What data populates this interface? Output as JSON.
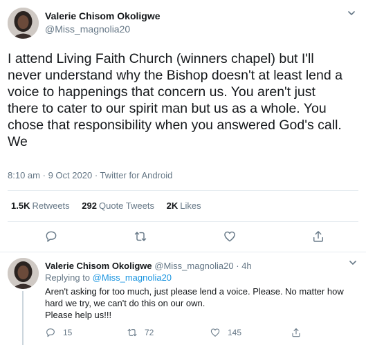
{
  "main_tweet": {
    "author_name": "Valerie Chisom Okoligwe",
    "author_handle": "@Miss_magnolia20",
    "text": "I attend Living Faith Church (winners chapel) but I'll\nnever understand why the Bishop doesn't at least lend a\nvoice to happenings that concern us. You aren't just\nthere to cater to our spirit man but us as a whole. You\nchose that responsibility when you answered God's call.\nWe",
    "time": "8:10 am",
    "separator": "·",
    "date": "9 Oct 2020",
    "source": "Twitter for Android",
    "stats": {
      "retweets_count": "1.5K",
      "retweets_label": "Retweets",
      "quotes_count": "292",
      "quotes_label": "Quote Tweets",
      "likes_count": "2K",
      "likes_label": "Likes"
    }
  },
  "reply": {
    "author_name": "Valerie Chisom Okoligwe",
    "author_handle": "@Miss_magnolia20",
    "separator": "·",
    "time_ago": "4h",
    "replying_to_label": "Replying to",
    "replying_to_handle": "@Miss_magnolia20",
    "text": "Aren't asking for too much, just please lend a voice. Please. No matter how\nhard we try, we can't do this on our own.\nPlease help us!!!",
    "reply_count": "15",
    "retweet_count": "72",
    "like_count": "145"
  },
  "icons": {
    "more": "chevron-down-icon",
    "reply": "reply-icon",
    "retweet": "retweet-icon",
    "like": "heart-icon",
    "share": "share-icon"
  },
  "colors": {
    "text": "#14171a",
    "secondary": "#657786",
    "link": "#1b95e0",
    "divider": "#e6ecf0"
  }
}
